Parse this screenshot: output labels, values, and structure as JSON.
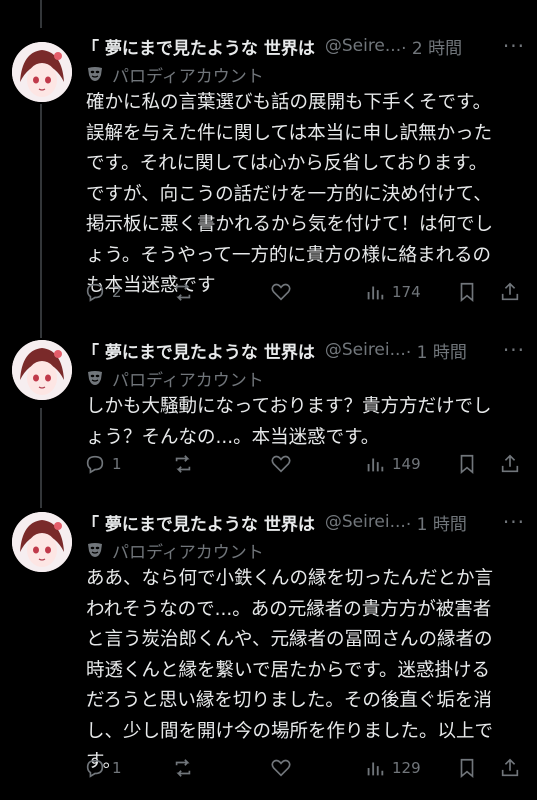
{
  "tweets": [
    {
      "display_name": "「 夢にまで見たような 世界は",
      "handle": "@Seire...",
      "time": "· 2 時間",
      "more": "···",
      "parody_label": "パロディアカウント",
      "lines": [
        "確かに私の言葉選びも話の展開も下手くそです。",
        "誤解を与えた件に関しては本当に申し訳無かった",
        "です。それに関しては心から反省しております。",
        "ですが、向こうの話だけを一方的に決め付けて、",
        "掲示板に悪く書かれるから気を付けて！は何でし",
        "ょう。そうやって一方的に貴方の様に絡まれるの",
        "も本当迷惑です"
      ],
      "replies": "2",
      "retweets": "",
      "likes": "",
      "views": "174"
    },
    {
      "display_name": "「 夢にまで見たような 世界は",
      "handle": "@Seirei...",
      "time": "· 1 時間",
      "more": "···",
      "parody_label": "パロディアカウント",
      "lines": [
        "しかも大騒動になっております？貴方方だけでし",
        "ょう？そんなの...。本当迷惑です。"
      ],
      "replies": "1",
      "retweets": "",
      "likes": "",
      "views": "149"
    },
    {
      "display_name": "「 夢にまで見たような 世界は",
      "handle": "@Seirei...",
      "time": "· 1 時間",
      "more": "···",
      "parody_label": "パロディアカウント",
      "lines": [
        "ああ、なら何で小鉄くんの縁を切ったんだとか言",
        "われそうなので...。あの元縁者の貴方方が被害者",
        "と言う炭治郎くんや、元縁者の冨岡さんの縁者の",
        "時透くんと縁を繋いで居たからです。迷惑掛ける",
        "だろうと思い縁を切りました。その後直ぐ垢を消",
        "し、少し間を開け今の場所を作りました。以上で",
        "す。"
      ],
      "replies": "1",
      "retweets": "",
      "likes": "",
      "views": "129"
    }
  ],
  "colors": {
    "background": "#000000",
    "text": "#e7e9ea",
    "secondary": "#71767b",
    "thread_line": "#333639"
  },
  "icons": [
    "avatar",
    "parody-mask-icon",
    "reply-icon",
    "retweet-icon",
    "like-icon",
    "views-icon",
    "bookmark-icon",
    "share-icon",
    "more-icon"
  ]
}
